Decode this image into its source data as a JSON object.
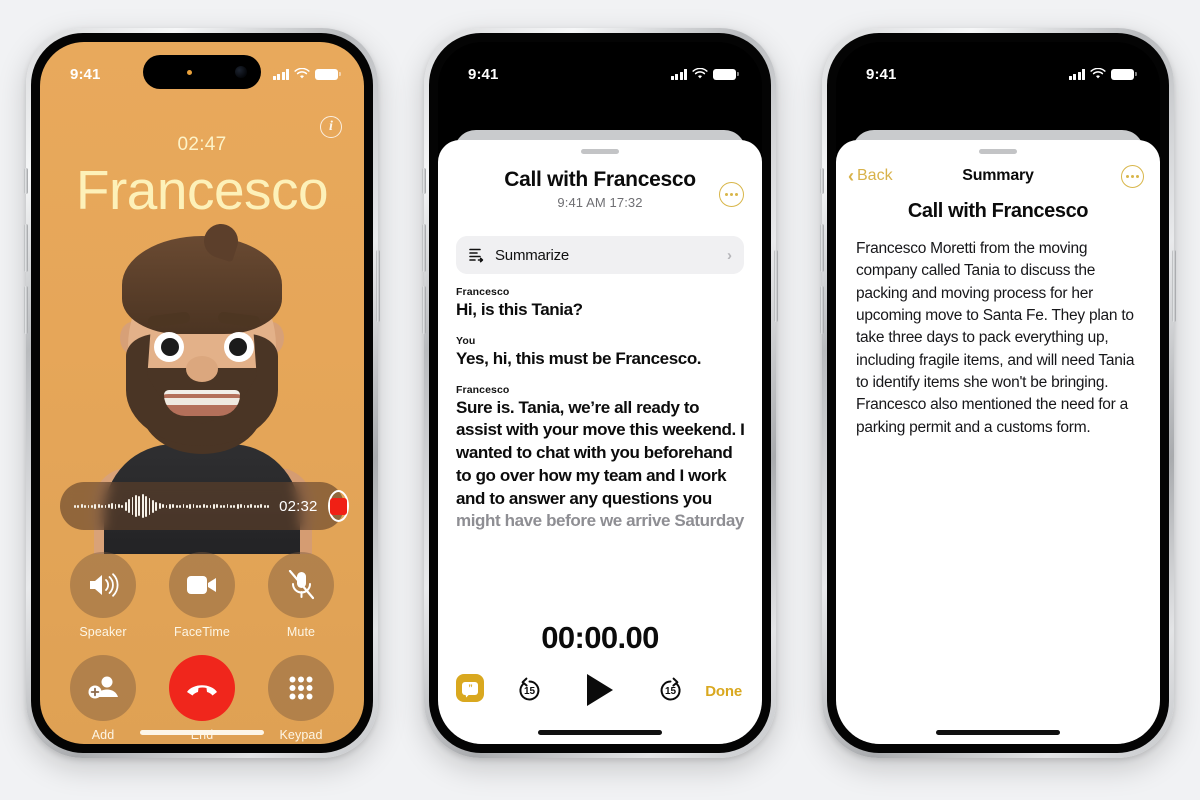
{
  "canvas": {
    "background": "#f1f2f4"
  },
  "phone1": {
    "status": {
      "time": "9:41",
      "signal_icon": "cellular-bars-icon",
      "wifi_icon": "wifi-icon",
      "battery_icon": "battery-icon"
    },
    "info_icon": "info-icon",
    "call": {
      "duration": "02:47",
      "contact_name": "Francesco",
      "name_color": "#fdf1b9",
      "background_color": "#e6a659"
    },
    "recording": {
      "elapsed": "02:32",
      "record_icon": "stop-record-icon",
      "waveform_icon": "audio-waveform-icon"
    },
    "controls": [
      {
        "label": "Speaker",
        "icon": "speaker-icon"
      },
      {
        "label": "FaceTime",
        "icon": "video-camera-icon"
      },
      {
        "label": "Mute",
        "icon": "microphone-muted-icon"
      },
      {
        "label": "Add",
        "icon": "add-person-icon"
      },
      {
        "label": "End",
        "icon": "end-call-icon",
        "color": "#f0261c"
      },
      {
        "label": "Keypad",
        "icon": "keypad-icon"
      }
    ]
  },
  "phone2": {
    "status": {
      "time": "9:41",
      "signal_icon": "cellular-bars-icon",
      "wifi_icon": "wifi-icon",
      "battery_icon": "battery-icon"
    },
    "header": {
      "title": "Call with Francesco",
      "subtitle": "9:41 AM  17:32",
      "more_icon": "more-circle-icon"
    },
    "summarize": {
      "label": "Summarize",
      "icon": "summarize-icon",
      "chevron": "›"
    },
    "transcript": [
      {
        "speaker": "Francesco",
        "text": "Hi, is this Tania?",
        "faded": false
      },
      {
        "speaker": "You",
        "text": "Yes, hi, this must be Francesco.",
        "faded": false
      },
      {
        "speaker": "Francesco",
        "text": "Sure is. Tania, we’re all ready to assist with your move this weekend. I wanted to chat with you beforehand to go over how my team and I work and to answer any questions you",
        "faded": false
      },
      {
        "speaker": "",
        "text": "might have before we arrive Saturday",
        "faded": true
      }
    ],
    "player": {
      "time": "00:00.00",
      "rewind_label": "15",
      "forward_label": "15",
      "rewind_icon": "rewind-15-icon",
      "play_icon": "play-icon",
      "forward_icon": "forward-15-icon"
    },
    "transcript_toggle_icon": "transcript-bubble-icon",
    "done_label": "Done",
    "accent_color": "#d9a81f"
  },
  "phone3": {
    "status": {
      "time": "9:41",
      "signal_icon": "cellular-bars-icon",
      "wifi_icon": "wifi-icon",
      "battery_icon": "battery-icon"
    },
    "nav": {
      "back_label": "Back",
      "back_icon": "chevron-left-icon",
      "title": "Summary",
      "more_icon": "more-circle-icon"
    },
    "heading": "Call with Francesco",
    "body": "Francesco Moretti from the moving company called Tania to discuss the packing and moving process for her upcoming move to Santa Fe. They plan to take three days to pack everything up, including fragile items, and will need Tania to identify items she won't be bringing. Francesco also mentioned the need for a parking permit and a customs form.",
    "accent_color": "#d8b24a"
  }
}
